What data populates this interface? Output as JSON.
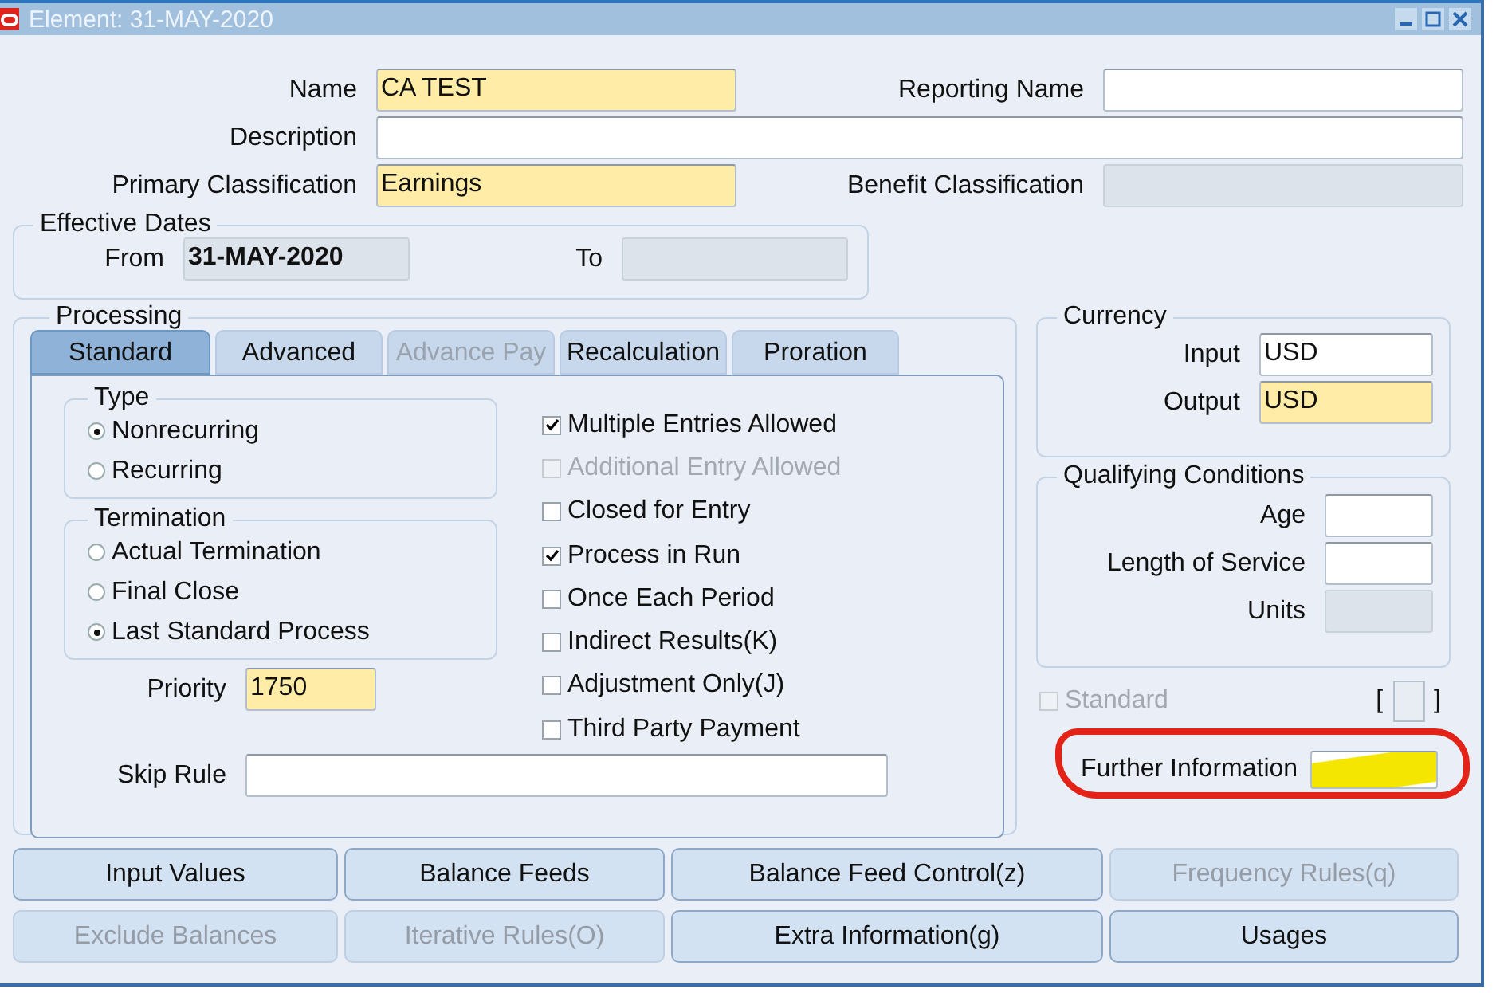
{
  "window": {
    "title": "Element: 31-MAY-2020"
  },
  "name": {
    "label": "Name",
    "value": "CA TEST",
    "required": true,
    "disabled": false
  },
  "reporting_name": {
    "label": "Reporting Name",
    "required": false,
    "disabled": false
  },
  "description": {
    "label": "Description",
    "required": false,
    "disabled": false
  },
  "primary_classification": {
    "label": "Primary Classification",
    "value": "Earnings",
    "required": true,
    "disabled": false
  },
  "benefit_classification": {
    "label": "Benefit Classification",
    "required": false,
    "disabled": true
  },
  "effective_dates": {
    "title": "Effective Dates",
    "from": {
      "label": "From",
      "value": "31-MAY-2020",
      "required": false,
      "disabled": true
    },
    "to": {
      "label": "To",
      "required": false,
      "disabled": true
    }
  },
  "processing": {
    "title": "Processing",
    "tabs": [
      {
        "label": "Standard",
        "selected": true,
        "disabled": false
      },
      {
        "label": "Advanced",
        "selected": false,
        "disabled": false
      },
      {
        "label": "Advance Pay",
        "selected": false,
        "disabled": true
      },
      {
        "label": "Recalculation",
        "selected": false,
        "disabled": false
      },
      {
        "label": "Proration",
        "selected": false,
        "disabled": false
      }
    ],
    "type": {
      "title": "Type",
      "options": [
        {
          "label": "Nonrecurring",
          "selected": true
        },
        {
          "label": "Recurring",
          "selected": false
        }
      ]
    },
    "termination": {
      "title": "Termination",
      "options": [
        {
          "label": "Actual Termination",
          "selected": false
        },
        {
          "label": "Final Close",
          "selected": false
        },
        {
          "label": "Last Standard Process",
          "selected": true
        }
      ]
    },
    "checkboxes": [
      {
        "label": "Multiple Entries Allowed",
        "checked": true,
        "disabled": false
      },
      {
        "label": "Additional Entry Allowed",
        "checked": false,
        "disabled": true
      },
      {
        "label": "Closed for Entry",
        "checked": false,
        "disabled": false
      },
      {
        "label": "Process in Run",
        "checked": true,
        "disabled": false
      },
      {
        "label": "Once Each Period",
        "checked": false,
        "disabled": false
      },
      {
        "label": "Indirect Results(K)",
        "checked": false,
        "disabled": false
      },
      {
        "label": "Adjustment Only(J)",
        "checked": false,
        "disabled": false
      },
      {
        "label": "Third Party Payment",
        "checked": false,
        "disabled": false
      }
    ],
    "priority": {
      "label": "Priority",
      "value": "1750",
      "required": true,
      "disabled": false
    },
    "skip_rule": {
      "label": "Skip Rule",
      "required": false,
      "disabled": false
    }
  },
  "currency": {
    "title": "Currency",
    "input": {
      "label": "Input",
      "value": "USD",
      "required": false,
      "disabled": false
    },
    "output": {
      "label": "Output",
      "value": "USD",
      "required": true,
      "disabled": false
    }
  },
  "qualifying_conditions": {
    "title": "Qualifying Conditions",
    "fields": [
      {
        "label": "Age",
        "required": false,
        "disabled": false
      },
      {
        "label": "Length of Service",
        "required": false,
        "disabled": false
      },
      {
        "label": "Units",
        "required": false,
        "disabled": true
      }
    ]
  },
  "standard": {
    "label": "Standard",
    "checked": false,
    "disabled": true
  },
  "flexfield": {
    "open": "[",
    "close": "]"
  },
  "further_information": {
    "label": "Further Information"
  },
  "buttons": [
    [
      {
        "label": "Input Values",
        "disabled": false
      },
      {
        "label": "Balance Feeds",
        "disabled": false
      },
      {
        "label": "Balance Feed Control(z)",
        "disabled": false
      },
      {
        "label": "Frequency Rules(q)",
        "disabled": true
      }
    ],
    [
      {
        "label": "Exclude Balances",
        "disabled": true
      },
      {
        "label": "Iterative Rules(O)",
        "disabled": true
      },
      {
        "label": "Extra Information(g)",
        "disabled": false
      },
      {
        "label": "Usages",
        "disabled": false
      }
    ]
  ]
}
